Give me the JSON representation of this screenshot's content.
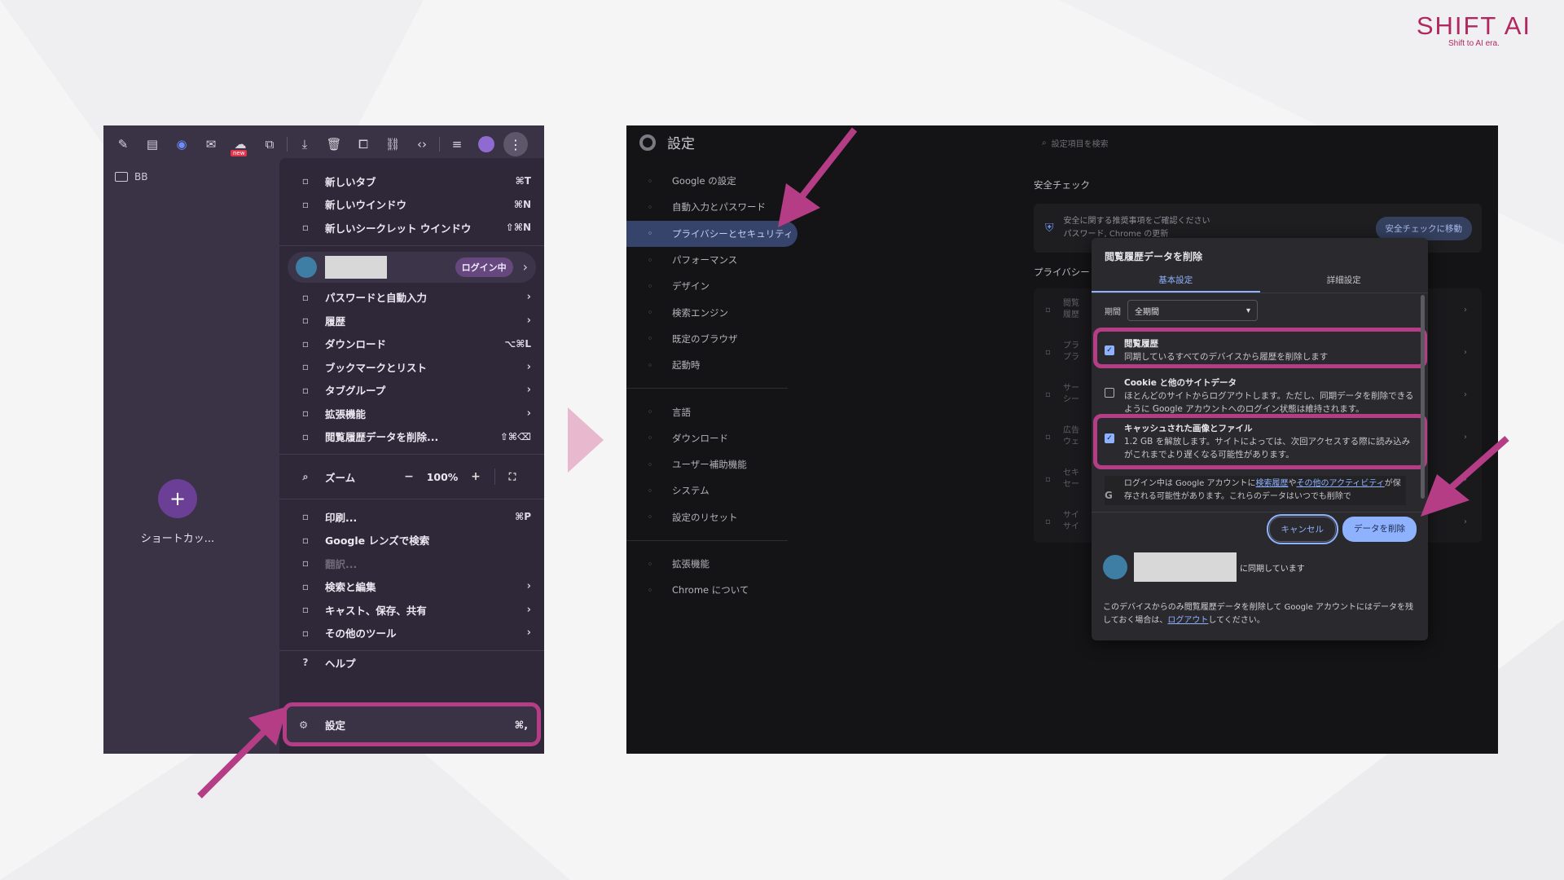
{
  "brand": {
    "name": "SHIFT AI",
    "tagline": "Shift to AI era."
  },
  "colors": {
    "accent": "#b43d86",
    "link": "#8fb2ff",
    "menu_bg": "#2e2838",
    "settings_bg": "#141416"
  },
  "left": {
    "toolbar": {
      "icons": [
        "pen-icon",
        "file-icon",
        "gear-ext-icon",
        "mail-icon",
        "new-ext-icon",
        "puzzle-icon",
        "download-icon",
        "trash-icon",
        "copy-icon",
        "link-icon",
        "code-icon",
        "playlist-icon",
        "avatar-icon",
        "more-vert-icon"
      ],
      "new_badge": "new"
    },
    "bookmark": "BB",
    "shortcut": {
      "label": "ショートカッ..."
    },
    "menu": {
      "group1": [
        {
          "icon": "tab-icon",
          "label": "新しいタブ",
          "shortcut": "⌘T"
        },
        {
          "icon": "window-icon",
          "label": "新しいウインドウ",
          "shortcut": "⌘N"
        },
        {
          "icon": "incognito-icon",
          "label": "新しいシークレット ウインドウ",
          "shortcut": "⇧⌘N"
        }
      ],
      "profile": {
        "badge": "ログイン中"
      },
      "group2": [
        {
          "icon": "key-icon",
          "label": "パスワードと自動入力",
          "shortcut": "",
          "arrow": true
        },
        {
          "icon": "history-icon",
          "label": "履歴",
          "shortcut": "",
          "arrow": true
        },
        {
          "icon": "download-icon",
          "label": "ダウンロード",
          "shortcut": "⌥⌘L",
          "arrow": false
        },
        {
          "icon": "star-icon",
          "label": "ブックマークとリスト",
          "shortcut": "",
          "arrow": true
        },
        {
          "icon": "tab-group-icon",
          "label": "タブグループ",
          "shortcut": "",
          "arrow": true
        },
        {
          "icon": "extension-icon",
          "label": "拡張機能",
          "shortcut": "",
          "arrow": true
        },
        {
          "icon": "trash-icon",
          "label": "閲覧履歴データを削除...",
          "shortcut": "⇧⌘⌫",
          "arrow": false
        }
      ],
      "zoom": {
        "label": "ズーム",
        "minus": "−",
        "value": "100%",
        "plus": "+"
      },
      "group3": [
        {
          "icon": "print-icon",
          "label": "印刷...",
          "shortcut": "⌘P",
          "arrow": false,
          "disabled": false
        },
        {
          "icon": "lens-icon",
          "label": "Google レンズで検索",
          "shortcut": "",
          "arrow": false,
          "disabled": false
        },
        {
          "icon": "translate-icon",
          "label": "翻訳...",
          "shortcut": "",
          "arrow": false,
          "disabled": true
        },
        {
          "icon": "find-icon",
          "label": "検索と編集",
          "shortcut": "",
          "arrow": true,
          "disabled": false
        },
        {
          "icon": "cast-icon",
          "label": "キャスト、保存、共有",
          "shortcut": "",
          "arrow": true,
          "disabled": false
        },
        {
          "icon": "toolbox-icon",
          "label": "その他のツール",
          "shortcut": "",
          "arrow": true,
          "disabled": false
        }
      ],
      "help": {
        "label": "ヘルプ"
      },
      "settings": {
        "label": "設定",
        "shortcut": "⌘,"
      }
    }
  },
  "right": {
    "title": "設定",
    "search_placeholder": "設定項目を検索",
    "nav": [
      {
        "icon": "google-icon",
        "label": "Google の設定",
        "active": false
      },
      {
        "icon": "key-icon",
        "label": "自動入力とパスワード",
        "active": false
      },
      {
        "icon": "shield-icon",
        "label": "プライバシーとセキュリティ",
        "active": true
      },
      {
        "icon": "performance-icon",
        "label": "パフォーマンス",
        "active": false
      },
      {
        "icon": "palette-icon",
        "label": "デザイン",
        "active": false
      },
      {
        "icon": "search-icon",
        "label": "検索エンジン",
        "active": false
      },
      {
        "icon": "browser-icon",
        "label": "既定のブラウザ",
        "active": false
      },
      {
        "icon": "power-icon",
        "label": "起動時",
        "active": false
      }
    ],
    "nav2": [
      {
        "icon": "language-icon",
        "label": "言語"
      },
      {
        "icon": "download-icon",
        "label": "ダウンロード"
      },
      {
        "icon": "accessibility-icon",
        "label": "ユーザー補助機能"
      },
      {
        "icon": "wrench-icon",
        "label": "システム"
      },
      {
        "icon": "reset-icon",
        "label": "設定のリセット"
      }
    ],
    "nav3": [
      {
        "icon": "extension-icon",
        "label": "拡張機能"
      },
      {
        "icon": "chrome-icon",
        "label": "Chrome について"
      }
    ],
    "safety": {
      "title": "安全チェック",
      "line1": "安全に関する推奨事項をご確認ください",
      "line2": "パスワード, Chrome の更新",
      "button": "安全チェックに移動"
    },
    "privacy_title": "プライバシー",
    "privacy_rows": [
      {
        "l1": "閲覧",
        "l2": "履歴"
      },
      {
        "l1": "プラ",
        "l2": "プラ"
      },
      {
        "l1": "サー",
        "l2": "シー"
      },
      {
        "l1": "広告",
        "l2": "ウェ"
      },
      {
        "l1": "セキ",
        "l2": "セー"
      },
      {
        "l1": "サイ",
        "l2": "サイ"
      }
    ],
    "dialog": {
      "title": "閲覧履歴データを削除",
      "tabs": [
        "基本設定",
        "詳細設定"
      ],
      "period_label": "期間",
      "period_value": "全期間",
      "options": [
        {
          "title": "閲覧履歴",
          "desc": "同期しているすべてのデバイスから履歴を削除します",
          "checked": true
        },
        {
          "title": "Cookie と他のサイトデータ",
          "desc": "ほとんどのサイトからログアウトします。ただし、同期データを削除できるように Google アカウントへのログイン状態は維持されます。",
          "checked": false
        },
        {
          "title": "キャッシュされた画像とファイル",
          "desc": "1.2 GB を解放します。サイトによっては、次回アクセスする際に読み込みがこれまでより遅くなる可能性があります。",
          "checked": true
        }
      ],
      "note": {
        "pre": "ログイン中は Google アカウントに",
        "link1": "検索履歴",
        "mid": "や",
        "link2": "その他のアクティビティ",
        "post": "が保存される可能性があります。これらのデータはいつでも削除で"
      },
      "cancel": "キャンセル",
      "delete": "データを削除",
      "sync_text": "に同期しています",
      "bottom_pre": "このデバイスからのみ閲覧履歴データを削除して Google アカウントにはデータを残しておく場合は、",
      "bottom_link": "ログアウト",
      "bottom_post": "してください。"
    }
  }
}
